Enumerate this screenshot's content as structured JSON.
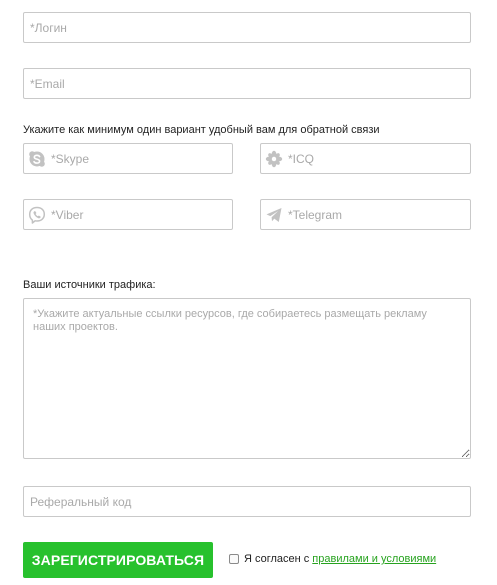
{
  "form": {
    "login_placeholder": "*Логин",
    "email_placeholder": "*Email",
    "contact_hint": "Укажите как минимум один вариант удобный вам для обратной связи",
    "skype_placeholder": "*Skype",
    "icq_placeholder": "*ICQ",
    "viber_placeholder": "*Viber",
    "telegram_placeholder": "*Telegram",
    "traffic_label": "Ваши источники трафика:",
    "traffic_placeholder": "*Укажите актуальные ссылки ресурсов, где собираетесь размещать рекламу наших проектов.",
    "referral_placeholder": "Реферальный код",
    "submit_label": "ЗАРЕГИСТРИРОВАТЬСЯ",
    "agree_text": "Я согласен с",
    "agree_link": "правилами и условиями"
  },
  "icons": {
    "skype": "skype-icon",
    "icq": "icq-flower-icon",
    "viber": "viber-icon",
    "telegram": "telegram-icon"
  },
  "colors": {
    "accent": "#27c12d",
    "link": "#27a31f",
    "border": "#c9c9c9",
    "icon": "#c2c2c2",
    "placeholder": "#a9a9a9"
  }
}
